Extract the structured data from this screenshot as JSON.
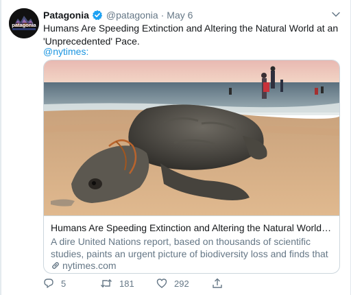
{
  "tweet": {
    "author_name": "Patagonia",
    "author_handle": "@patagonia",
    "separator": "·",
    "date": "May 6",
    "text": "Humans Are Speeding Extinction and Altering the Natural World at an 'Unprecedented' Pace.",
    "mention": "@nytimes:",
    "avatar_text": "patagonia"
  },
  "card": {
    "title": "Humans Are Speeding Extinction and Altering the Natural World at an 'Un...",
    "description": "A dire United Nations report, based on thousands of scientific studies, paints an urgent picture of biodiversity loss and finds that climate change...",
    "domain": "nytimes.com",
    "image_subject": "sea turtle on beach"
  },
  "actions": {
    "replies": "5",
    "retweets": "181",
    "likes": "292"
  },
  "colors": {
    "link": "#1b95e0",
    "verified": "#1da1f2",
    "muted": "#657786",
    "border": "#ccd6dd"
  }
}
